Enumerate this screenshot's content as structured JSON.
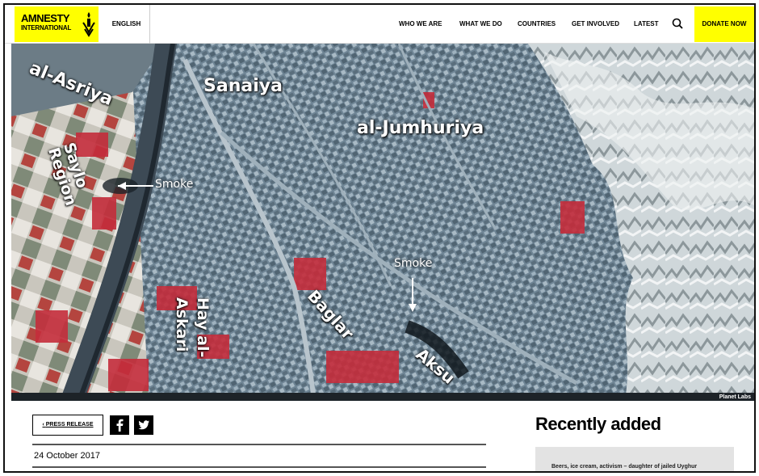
{
  "header": {
    "logo_line1": "AMNESTY",
    "logo_line2": "INTERNATIONAL",
    "language": "ENGLISH",
    "nav": [
      "WHO WE ARE",
      "WHAT WE DO",
      "COUNTRIES",
      "GET INVOLVED",
      "LATEST"
    ],
    "donate_label": "DONATE NOW",
    "brand_color": "#ffff00"
  },
  "satellite": {
    "places": [
      "al-Asriya",
      "Sanaiya",
      "al-Jumhuriya",
      "Saylo Region",
      "Hay al-Askari",
      "Baglar",
      "Aksu"
    ],
    "smoke_labels": [
      "Smoke",
      "Smoke"
    ],
    "credit": "Planet Labs"
  },
  "article": {
    "press_release_label": "PRESS RELEASE",
    "social": [
      "facebook-icon",
      "twitter-icon"
    ],
    "date": "24 October 2017"
  },
  "sidebar": {
    "title": "Recently added",
    "card_text": "Beers, ice cream, activism – daughter of jailed Uyghur"
  }
}
